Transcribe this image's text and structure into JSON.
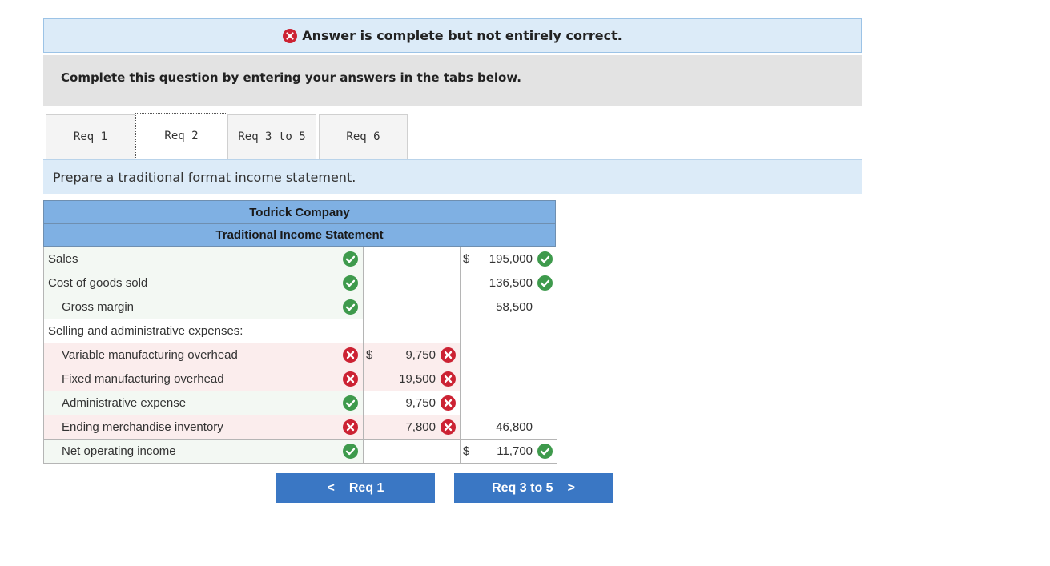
{
  "banner": {
    "text": "Answer is complete but not entirely correct."
  },
  "instruction": "Complete this question by entering your answers in the tabs below.",
  "tabs": [
    {
      "label": "Req 1"
    },
    {
      "label": "Req 2"
    },
    {
      "label": "Req 3 to 5"
    },
    {
      "label": "Req 6"
    }
  ],
  "prompt": "Prepare a traditional format income statement.",
  "statement": {
    "company": "Todrick Company",
    "title": "Traditional Income Statement",
    "rows": [
      {
        "label": "Sales",
        "col2_dollar": "$",
        "col2": "195,000"
      },
      {
        "label": "Cost of goods sold",
        "col2": "136,500"
      },
      {
        "label": "Gross margin",
        "col2": "58,500"
      },
      {
        "label": "Selling and administrative expenses:"
      },
      {
        "label": "Variable manufacturing overhead",
        "col1_dollar": "$",
        "col1": "9,750"
      },
      {
        "label": "Fixed manufacturing overhead",
        "col1": "19,500"
      },
      {
        "label": "Administrative expense",
        "col1": "9,750"
      },
      {
        "label": "Ending merchandise inventory",
        "col1": "7,800",
        "col2": "46,800"
      },
      {
        "label": "Net operating income",
        "col2_dollar": "$",
        "col2": "11,700"
      }
    ]
  },
  "nav": {
    "prev": "Req 1",
    "next": "Req 3 to 5"
  },
  "colors": {
    "correct": "#3e9a4c",
    "incorrect": "#cc2233",
    "accent": "#3a77c4"
  }
}
